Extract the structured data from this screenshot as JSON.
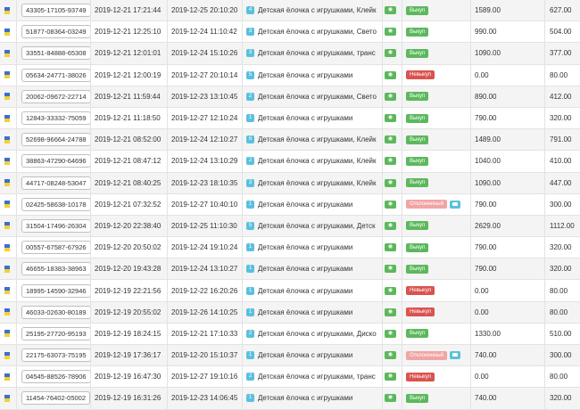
{
  "rows": [
    {
      "track": "43305-17105-93749",
      "created": "2019-12-21 17:21:44",
      "changed": "2019-12-25 20:10:20",
      "qty": "4",
      "product": "Детская ёлочка с игрушками, Клейк",
      "status": "Выкуп",
      "status_color": "green",
      "price": "1589.00",
      "amount": "627.00",
      "comment": false
    },
    {
      "track": "51877-08364-03249",
      "created": "2019-12-21 12:25:10",
      "changed": "2019-12-24 11:10:42",
      "qty": "3",
      "product": "Детская ёлочка с игрушками, Свето",
      "status": "Выкуп",
      "status_color": "green",
      "price": "990.00",
      "amount": "504.00",
      "comment": false
    },
    {
      "track": "33551-84888-65308",
      "created": "2019-12-21 12:01:01",
      "changed": "2019-12-24 15:10:26",
      "qty": "3",
      "product": "Детская ёлочка с игрушками, транс",
      "status": "Выкуп",
      "status_color": "green",
      "price": "1090.00",
      "amount": "377.00",
      "comment": false
    },
    {
      "track": "05634-24771-38026",
      "created": "2019-12-21 12:00:19",
      "changed": "2019-12-27 20:10:14",
      "qty": "5",
      "product": "Детская ёлочка с игрушками",
      "status": "Невыкуп",
      "status_color": "red",
      "price": "0.00",
      "amount": "80.00",
      "comment": false
    },
    {
      "track": "20062-09672-22714",
      "created": "2019-12-21 11:59:44",
      "changed": "2019-12-23 13:10:45",
      "qty": "2",
      "product": "Детская ёлочка с игрушками, Свето",
      "status": "Выкуп",
      "status_color": "green",
      "price": "890.00",
      "amount": "412.00",
      "comment": false
    },
    {
      "track": "12843-33332-75059",
      "created": "2019-12-21 11:18:50",
      "changed": "2019-12-27 12:10:24",
      "qty": "1",
      "product": "Детская ёлочка с игрушками",
      "status": "Выкуп",
      "status_color": "green",
      "price": "790.00",
      "amount": "320.00",
      "comment": false
    },
    {
      "track": "52698-96664-24788",
      "created": "2019-12-21 08:52:00",
      "changed": "2019-12-24 12:10:27",
      "qty": "6",
      "product": "Детская ёлочка с игрушками, Клейк",
      "status": "Выкуп",
      "status_color": "green",
      "price": "1489.00",
      "amount": "791.00",
      "comment": false
    },
    {
      "track": "38863-47290-64696",
      "created": "2019-12-21 08:47:12",
      "changed": "2019-12-24 13:10:29",
      "qty": "2",
      "product": "Детская ёлочка с игрушками, Клейк",
      "status": "Выкуп",
      "status_color": "green",
      "price": "1040.00",
      "amount": "410.00",
      "comment": false
    },
    {
      "track": "44717-08248-53047",
      "created": "2019-12-21 08:40:25",
      "changed": "2019-12-23 18:10:35",
      "qty": "3",
      "product": "Детская ёлочка с игрушками, Клейк",
      "status": "Выкуп",
      "status_color": "green",
      "price": "1090.00",
      "amount": "447.00",
      "comment": false
    },
    {
      "track": "02425-58638-10178",
      "created": "2019-12-21 07:32:52",
      "changed": "2019-12-27 10:40:10",
      "qty": "1",
      "product": "Детская ёлочка с игрушками",
      "status": "Отклоненный",
      "status_color": "pink",
      "price": "790.00",
      "amount": "300.00",
      "comment": true
    },
    {
      "track": "31504-17496-26304",
      "created": "2019-12-20 22:38:40",
      "changed": "2019-12-25 11:10:30",
      "qty": "5",
      "product": "Детская ёлочка с игрушками, Детск",
      "status": "Выкуп",
      "status_color": "green",
      "price": "2629.00",
      "amount": "1112.00",
      "comment": false
    },
    {
      "track": "00557-67587-67926",
      "created": "2019-12-20 20:50:02",
      "changed": "2019-12-24 19:10:24",
      "qty": "1",
      "product": "Детская ёлочка с игрушками",
      "status": "Выкуп",
      "status_color": "green",
      "price": "790.00",
      "amount": "320.00",
      "comment": false
    },
    {
      "track": "46655-18383-38963",
      "created": "2019-12-20 19:43:28",
      "changed": "2019-12-24 13:10:27",
      "qty": "1",
      "product": "Детская ёлочка с игрушками",
      "status": "Выкуп",
      "status_color": "green",
      "price": "790.00",
      "amount": "320.00",
      "comment": false
    },
    {
      "track": "18995-14590-32946",
      "created": "2019-12-19 22:21:56",
      "changed": "2019-12-22 16:20:26",
      "qty": "1",
      "product": "Детская ёлочка с игрушками",
      "status": "Невыкуп",
      "status_color": "red",
      "price": "0.00",
      "amount": "80.00",
      "comment": false
    },
    {
      "track": "46033-02630-80189",
      "created": "2019-12-19 20:55:02",
      "changed": "2019-12-26 14:10:25",
      "qty": "1",
      "product": "Детская ёлочка с игрушками",
      "status": "Невыкуп",
      "status_color": "red",
      "price": "0.00",
      "amount": "80.00",
      "comment": false
    },
    {
      "track": "25195-27720-95193",
      "created": "2019-12-19 18:24:15",
      "changed": "2019-12-21 17:10:33",
      "qty": "2",
      "product": "Детская ёлочка с игрушками, Диско",
      "status": "Выкуп",
      "status_color": "green",
      "price": "1330.00",
      "amount": "510.00",
      "comment": false
    },
    {
      "track": "22175-63073-75195",
      "created": "2019-12-19 17:36:17",
      "changed": "2019-12-20 15:10:37",
      "qty": "1",
      "product": "Детская ёлочка с игрушками",
      "status": "Отклоненный",
      "status_color": "pink",
      "price": "740.00",
      "amount": "300.00",
      "comment": true
    },
    {
      "track": "04545-88526-78906",
      "created": "2019-12-19 16:47:30",
      "changed": "2019-12-27 19:10:16",
      "qty": "2",
      "product": "Детская ёлочка с игрушками, транс",
      "status": "Невыкуп",
      "status_color": "red",
      "price": "0.00",
      "amount": "80.00",
      "comment": false
    },
    {
      "track": "11454-76402-05002",
      "created": "2019-12-19 16:31:26",
      "changed": "2019-12-23 14:06:45",
      "qty": "1",
      "product": "Детская ёлочка с игрушками",
      "status": "Выкуп",
      "status_color": "green",
      "price": "740.00",
      "amount": "320.00",
      "comment": false
    }
  ]
}
